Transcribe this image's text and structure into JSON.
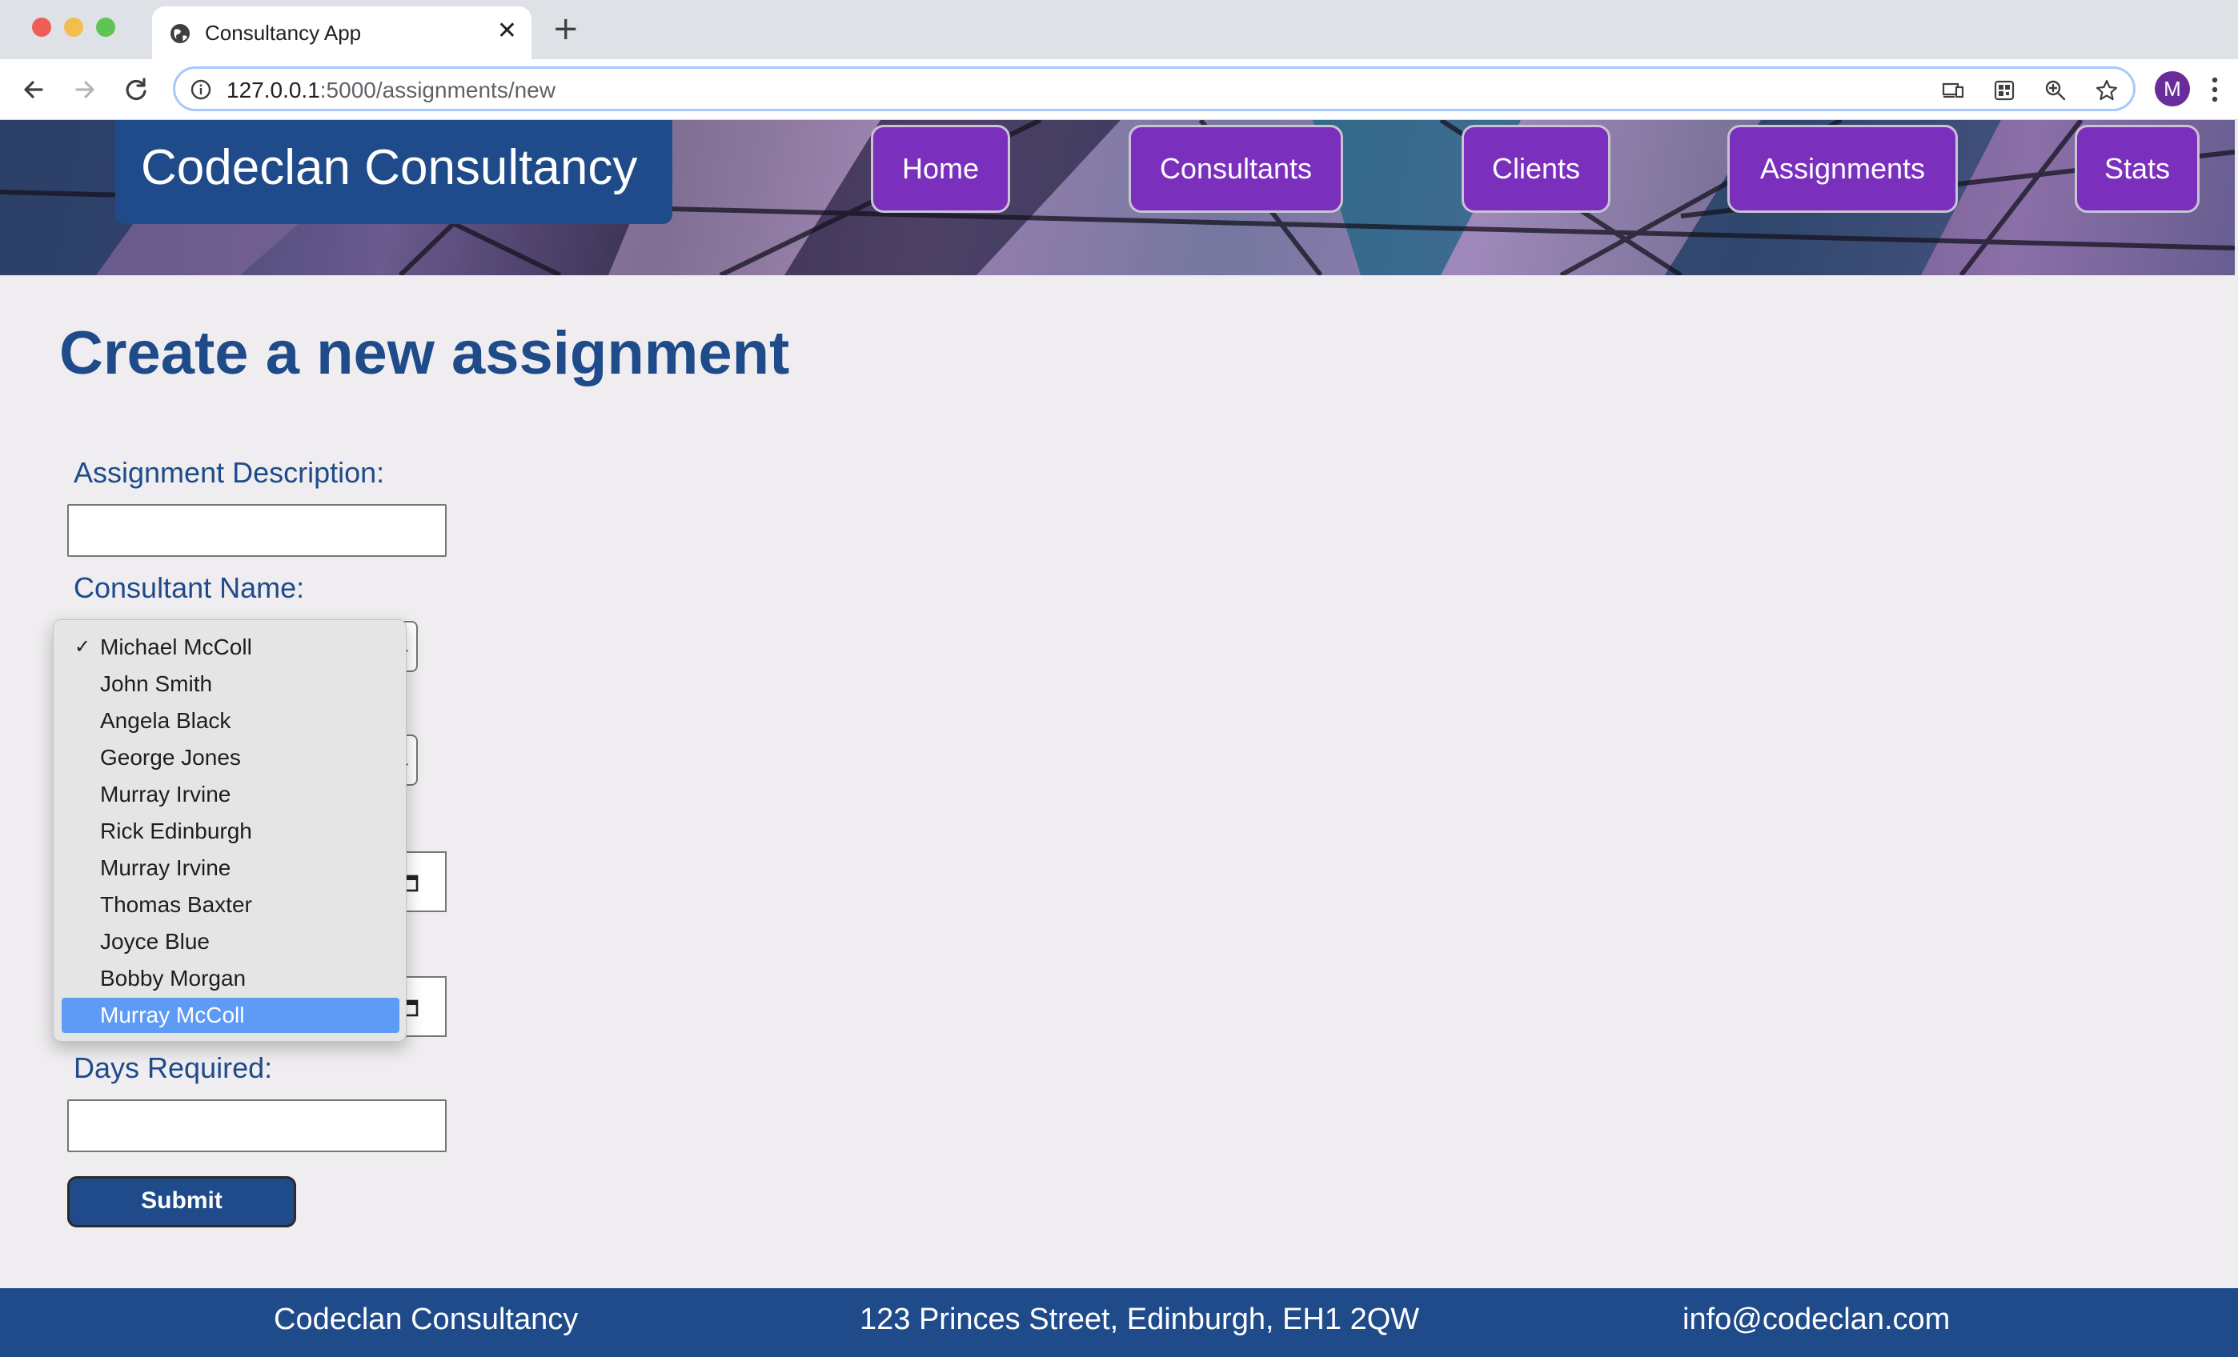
{
  "browser": {
    "tab_title": "Consultancy App",
    "tab_close": "✕",
    "new_tab": "+",
    "url_host": "127.0.0.1",
    "url_path": ":5000/assignments/new",
    "profile_initial": "M"
  },
  "header": {
    "brand": "Codeclan Consultancy",
    "nav": {
      "home": "Home",
      "consultants": "Consultants",
      "clients": "Clients",
      "assignments": "Assignments",
      "stats": "Stats"
    },
    "accent_color": "#7b2fbd",
    "brand_color": "#1f4b8a"
  },
  "form": {
    "title": "Create a new assignment",
    "description_label": "Assignment Description:",
    "description_value": "",
    "consultant_label": "Consultant Name:",
    "consultant_selected": "Michael McColl",
    "consultant_options": [
      "Michael McColl",
      "John Smith",
      "Angela Black",
      "George Jones",
      "Murray Irvine",
      "Rick Edinburgh",
      "Murray Irvine",
      "Thomas Baxter",
      "Joyce Blue",
      "Bobby Morgan",
      "Murray McColl"
    ],
    "highlighted_option": "Murray McColl",
    "days_label": "Days Required:",
    "days_value": "",
    "submit_label": "Submit"
  },
  "footer": {
    "company": "Codeclan Consultancy",
    "address": "123 Princes Street, Edinburgh, EH1 2QW",
    "email": "info@codeclan.com"
  }
}
